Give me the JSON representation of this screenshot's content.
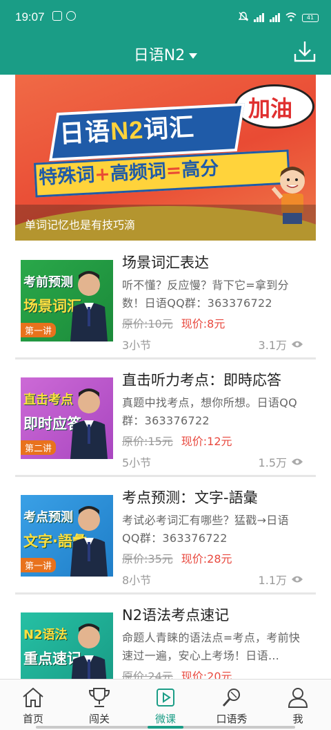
{
  "status_bar": {
    "time": "19:07",
    "battery": "41"
  },
  "header": {
    "title": "日语N2"
  },
  "banner": {
    "title_part1": "日语",
    "title_part2": "N2",
    "title_part3": "词汇",
    "subtitle_part1": "特殊词",
    "subtitle_op1": "+",
    "subtitle_part2": "高频词",
    "subtitle_op2": "=",
    "subtitle_part3": "高分",
    "bubble": "加油",
    "caption": "单词记忆也是有技巧滴"
  },
  "courses": [
    {
      "thumb_line1": "考前预测",
      "thumb_line2": "场景词汇",
      "thumb_tag": "第一讲",
      "thumb_color": "#2aa84a",
      "title": "场景词汇表达",
      "desc": "听不懂？反应慢？背下它=拿到分数！日语QQ群：363376722",
      "orig_price": "原价:10元",
      "now_price": "现价:8元",
      "lessons": "3小节",
      "views": "3.1万"
    },
    {
      "thumb_line1": "直击考点",
      "thumb_line2": "即时应答",
      "thumb_tag": "第二讲",
      "thumb_color": "#c45ad0",
      "title": "直击听力考点：即時応答",
      "desc": "真题中找考点，想你所想。日语QQ群：363376722",
      "orig_price": "原价:15元",
      "now_price": "现价:12元",
      "lessons": "5小节",
      "views": "1.5万"
    },
    {
      "thumb_line1": "考点预测",
      "thumb_line2": "文字·語彙",
      "thumb_tag": "第一讲",
      "thumb_color": "#2f8fd8",
      "title": "考点预测：文字-語彙",
      "desc": "考试必考词汇有哪些？猛戳→日语QQ群：363376722",
      "orig_price": "原价:35元",
      "now_price": "现价:28元",
      "lessons": "8小节",
      "views": "1.1万"
    },
    {
      "thumb_line1": "N2语法",
      "thumb_line2": "重点速记",
      "thumb_tag": "",
      "thumb_color": "#22b39a",
      "title": "N2语法考点速记",
      "desc": " 命题人青睐的语法点=考点，考前快速过一遍，安心上考场！日语…",
      "orig_price": "原价:24元",
      "now_price": "现价:20元",
      "lessons": "",
      "views": ""
    }
  ],
  "bottom_nav": {
    "home": "首页",
    "challenge": "闯关",
    "courses": "微课",
    "speaking": "口语秀",
    "me": "我"
  },
  "colors": {
    "primary": "#1a9d86",
    "price_red": "#e8483e"
  }
}
